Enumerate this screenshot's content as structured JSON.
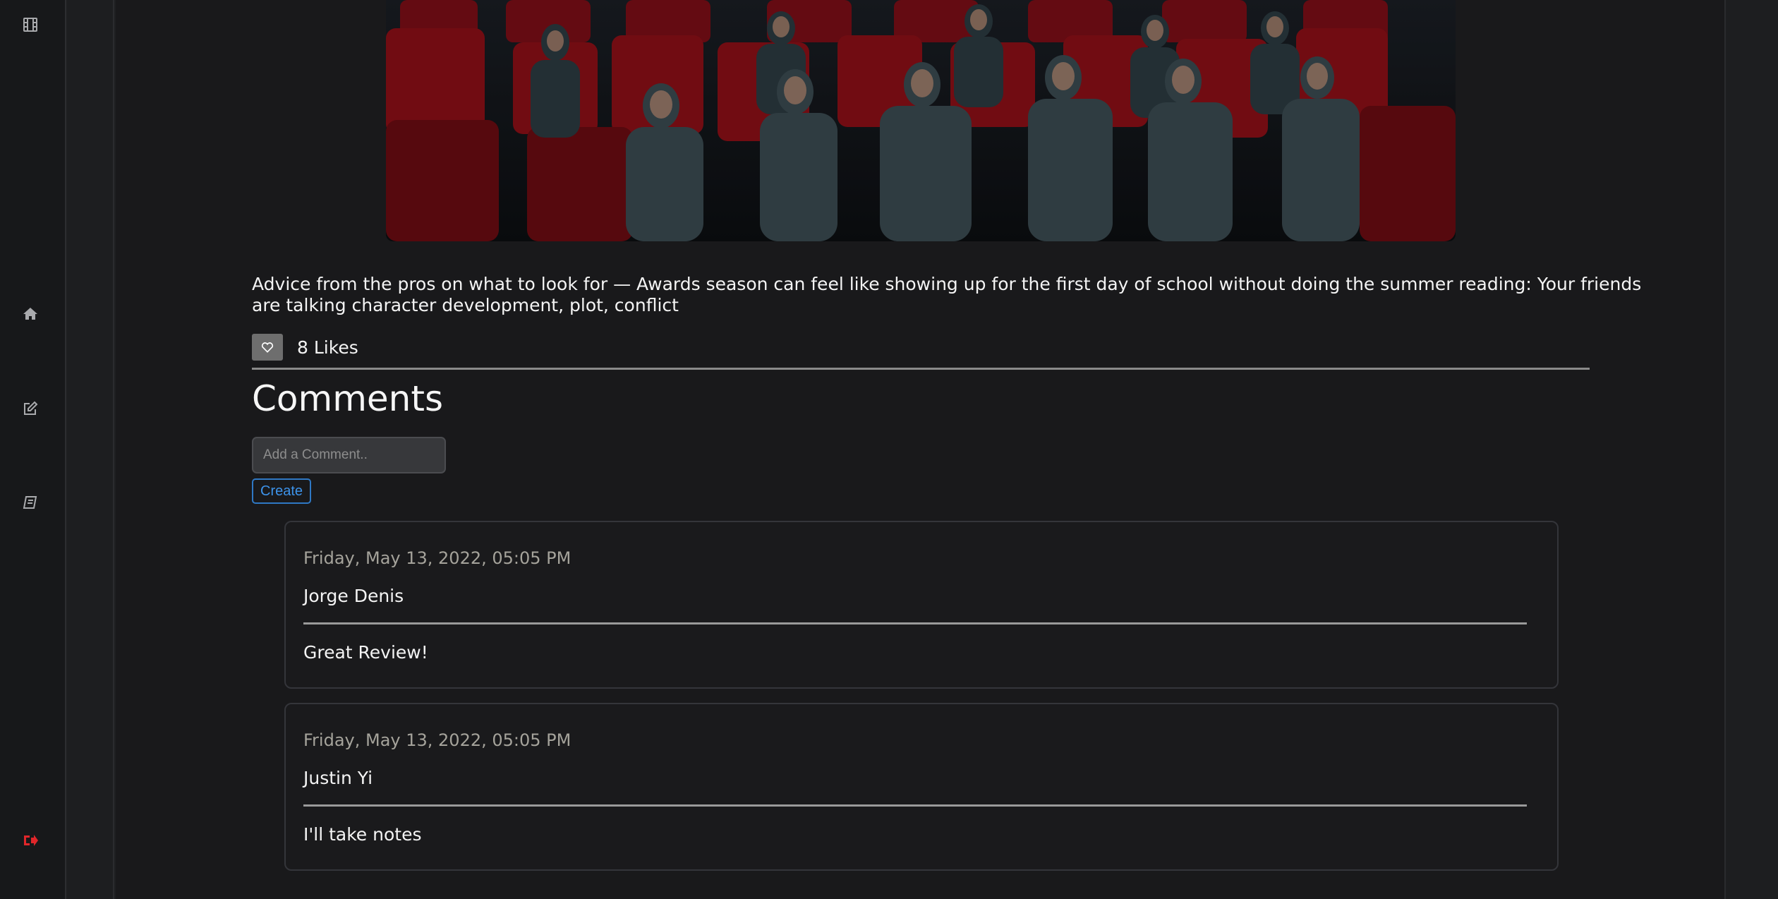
{
  "sidebar": {
    "items": [
      {
        "icon": "film-icon",
        "label": ""
      },
      {
        "icon": "home-icon",
        "label": ""
      },
      {
        "icon": "edit-icon",
        "label": ""
      },
      {
        "icon": "book-icon",
        "label": ""
      },
      {
        "icon": "logout-icon",
        "label": ""
      }
    ],
    "icon_color": "#a9aaad",
    "logout_color": "#e0262a"
  },
  "post": {
    "image": {
      "alt": "Audience in red cinema seats watching a film"
    },
    "description": "Advice from the pros on what to look for — Awards season can feel like showing up for the first day of school without doing the summer reading: Your friends are talking character development, plot, conflict",
    "likes_label": "8 Likes",
    "like_icon": "heart-icon"
  },
  "comments": {
    "title": "Comments",
    "input_placeholder": "Add a Comment..",
    "create_label": "Create",
    "items": [
      {
        "date": "Friday, May 13, 2022, 05:05 PM",
        "author": "Jorge Denis",
        "text": "Great Review!"
      },
      {
        "date": "Friday, May 13, 2022, 05:05 PM",
        "author": "Justin Yi",
        "text": "I'll take notes"
      }
    ]
  },
  "colors": {
    "accent_blue": "#3d93ea",
    "background": "#19191b",
    "seat_red": "#8a0f16"
  }
}
